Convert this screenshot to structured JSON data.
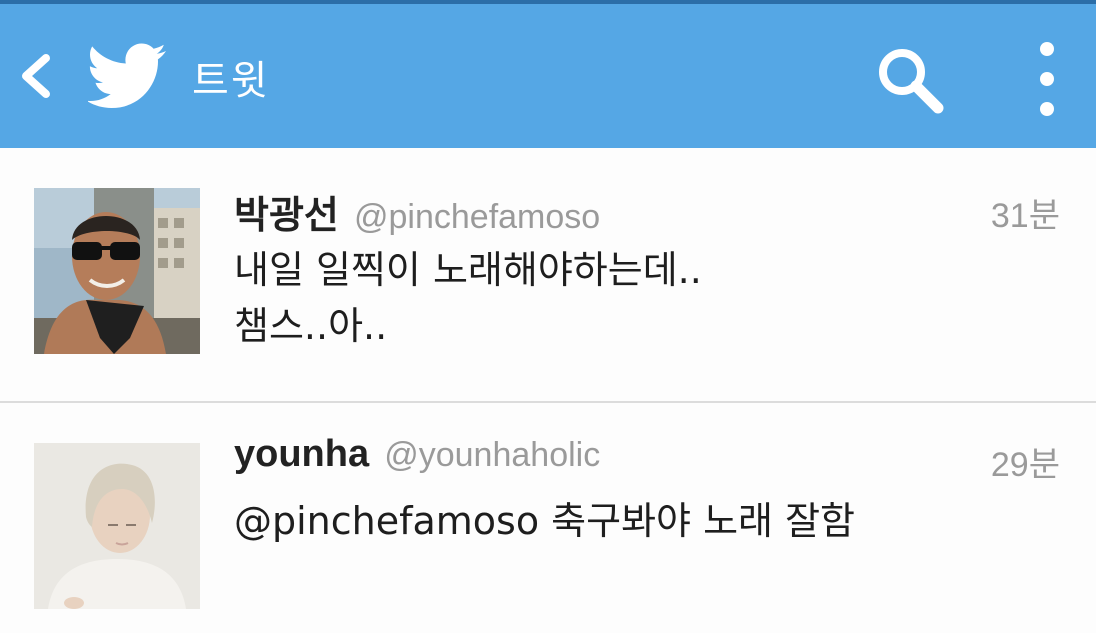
{
  "header": {
    "title": "트윗",
    "icons": [
      "back-icon",
      "twitter-bird-icon",
      "search-icon",
      "overflow-menu-icon"
    ],
    "background_color": "#55a7e5"
  },
  "tweets": [
    {
      "display_name": "박광선",
      "handle": "@pinchefamoso",
      "time": "31분",
      "text_lines": [
        "내일 일찍이 노래해야하는데..",
        "챔스..아.."
      ]
    },
    {
      "display_name": "younha",
      "handle": "@younhaholic",
      "time": "29분",
      "text_lines": [
        "@pinchefamoso 축구봐야 노래 잘함"
      ]
    }
  ]
}
